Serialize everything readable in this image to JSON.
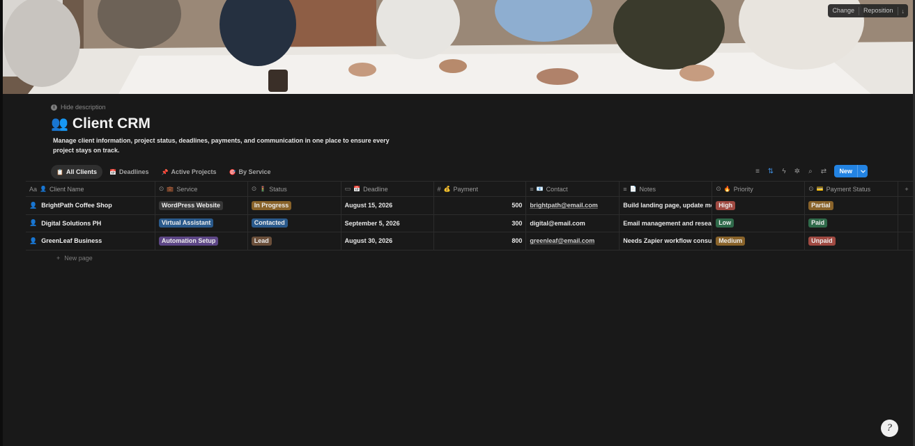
{
  "cover": {
    "change_label": "Change",
    "reposition_label": "Reposition",
    "download_icon": "download-icon"
  },
  "header": {
    "hide_description": "Hide description",
    "title_icon": "👥",
    "title": "Client CRM",
    "description": "Manage client information, project status, deadlines, payments, and communication in one place to ensure every project stays on track."
  },
  "tabs": [
    {
      "icon": "📋",
      "label": "All Clients",
      "active": true
    },
    {
      "icon": "📅",
      "label": "Deadlines",
      "active": false
    },
    {
      "icon": "📌",
      "label": "Active Projects",
      "active": false
    },
    {
      "icon": "🎯",
      "label": "By Service",
      "active": false
    }
  ],
  "toolbar": {
    "new_label": "New",
    "icons": [
      "filter-icon",
      "sort-icon",
      "automation-icon",
      "sparkle-icon",
      "search-icon",
      "settings-icon"
    ]
  },
  "columns": [
    {
      "type_icon": "Aa",
      "emoji": "👤",
      "label": "Client Name"
    },
    {
      "type_icon": "⊙",
      "emoji": "💼",
      "label": "Service"
    },
    {
      "type_icon": "⊙",
      "emoji": "🚦",
      "label": "Status"
    },
    {
      "type_icon": "▭",
      "emoji": "📅",
      "label": "Deadline"
    },
    {
      "type_icon": "#",
      "emoji": "💰",
      "label": "Payment"
    },
    {
      "type_icon": "≡",
      "emoji": "📧",
      "label": "Contact"
    },
    {
      "type_icon": "≡",
      "emoji": "📄",
      "label": "Notes"
    },
    {
      "type_icon": "⊙",
      "emoji": "🔥",
      "label": "Priority"
    },
    {
      "type_icon": "⊙",
      "emoji": "💳",
      "label": "Payment Status"
    }
  ],
  "rows": [
    {
      "name": "BrightPath Coffee Shop",
      "service": "WordPress Website",
      "service_color": "#373737",
      "status": "In Progress",
      "status_color": "#89632a",
      "deadline": "August 15, 2026",
      "payment": "500",
      "contact": "brightpath@email.com",
      "notes": "Build landing page, update menu",
      "priority": "High",
      "priority_color": "#a04a42",
      "payment_status": "Partial",
      "payment_status_color": "#89632a"
    },
    {
      "name": "Digital Solutions PH",
      "service": "Virtual Assistant",
      "service_color": "#2a5a8c",
      "status": "Contacted",
      "status_color": "#2a5a8c",
      "deadline": "September 5, 2026",
      "payment": "300",
      "contact": "digital@email.com",
      "notes": "Email management and research",
      "priority": "Low",
      "priority_color": "#2f6a4a",
      "payment_status": "Paid",
      "payment_status_color": "#2f6a4a"
    },
    {
      "name": "GreenLeaf Business",
      "service": "Automation Setup",
      "service_color": "#5e4787",
      "status": "Lead",
      "status_color": "#6b4f3a",
      "deadline": "August 30, 2026",
      "payment": "800",
      "contact": "greenleaf@email.com",
      "notes": "Needs Zapier workflow consultation",
      "priority": "Medium",
      "priority_color": "#89632a",
      "payment_status": "Unpaid",
      "payment_status_color": "#a04a42"
    }
  ],
  "new_page_label": "New page",
  "help_label": "?",
  "colors": {
    "background": "#191919",
    "accent": "#2383e2"
  }
}
